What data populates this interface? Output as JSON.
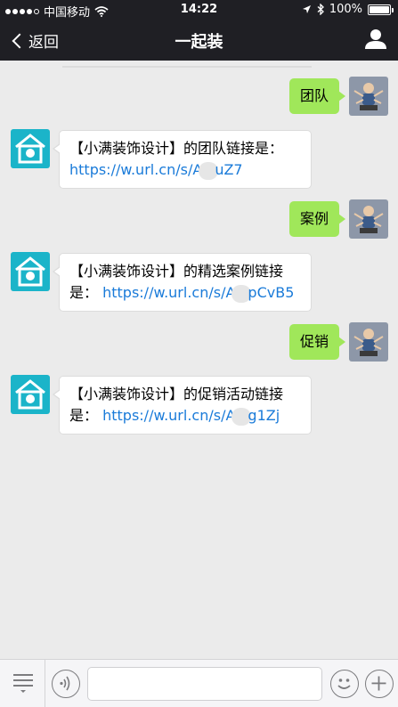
{
  "status": {
    "carrier": "中国移动",
    "time": "14:22",
    "battery": "100%"
  },
  "nav": {
    "back_label": "返回",
    "title": "一起装"
  },
  "messages": [
    {
      "from": "me",
      "text": "团队"
    },
    {
      "from": "bot",
      "prefix": "【小满装饰设计】的团队链接是：",
      "link_a": "https://w.url.cn/s/A",
      "link_b": "uZ7"
    },
    {
      "from": "me",
      "text": "案例"
    },
    {
      "from": "bot",
      "prefix": "【小满装饰设计】的精选案例链接",
      "line2": "是：",
      "link_a": "https://w.url.cn/s/A",
      "link_b": "pCvB5"
    },
    {
      "from": "me",
      "text": "促销"
    },
    {
      "from": "bot",
      "prefix": "【小满装饰设计】的促销活动链接",
      "line2": "是：",
      "link_a": "https://w.url.cn/s/A",
      "link_b": "g1Zj"
    }
  ],
  "input": {
    "placeholder": ""
  },
  "colors": {
    "topbar": "#1f1f24",
    "bubble_me": "#a0e75a",
    "link": "#1a7bd9",
    "bot_avatar": "#1bb4c9"
  }
}
